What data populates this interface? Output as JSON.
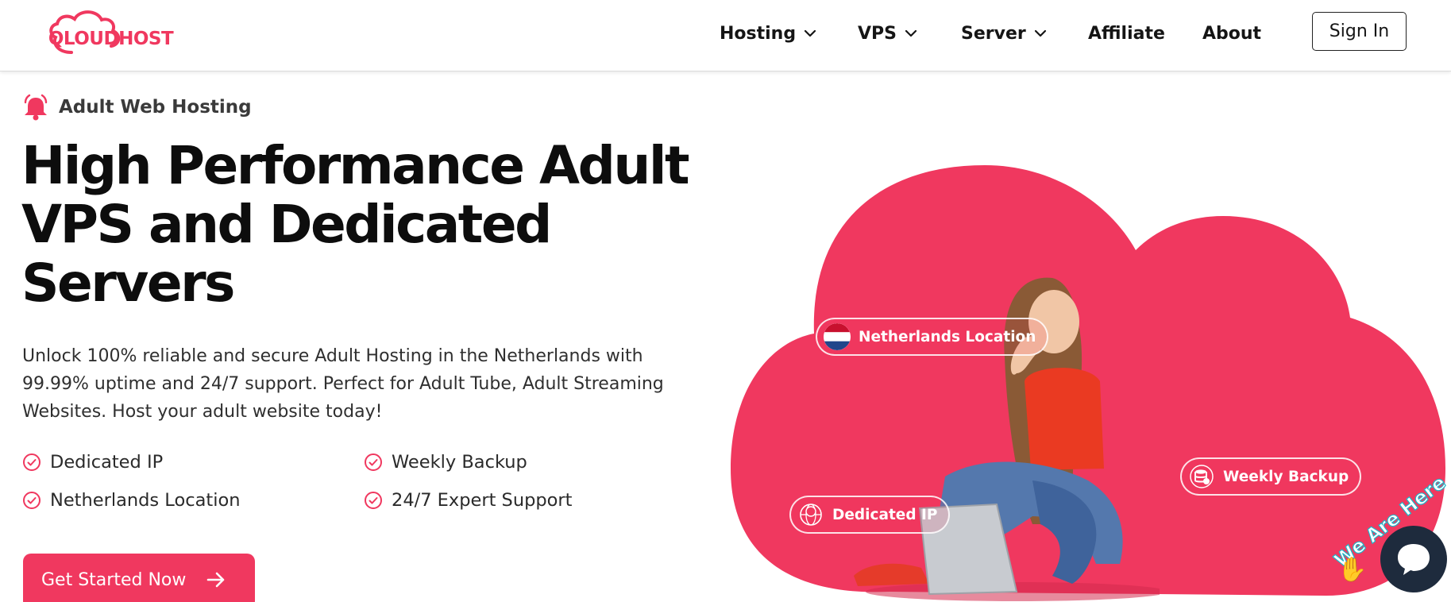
{
  "brand": {
    "logo_text_q": "Q",
    "logo_text_loud": "LOUD",
    "logo_text_host": "HOST",
    "color": "#f0385f"
  },
  "nav": {
    "items": [
      {
        "label": "Hosting",
        "has_dropdown": true
      },
      {
        "label": "VPS",
        "has_dropdown": true
      },
      {
        "label": "Server",
        "has_dropdown": true
      },
      {
        "label": "Affiliate",
        "has_dropdown": false
      },
      {
        "label": "About",
        "has_dropdown": false
      }
    ],
    "sign_in": "Sign In"
  },
  "hero": {
    "tagline_icon": "bell-icon",
    "tagline": "Adult Web Hosting",
    "headline_line1": "High Performance Adult",
    "headline_line2": "VPS and Dedicated",
    "headline_line3": "Servers",
    "description": "Unlock 100% reliable and secure Adult Hosting in the Netherlands with 99.99% uptime and 24/7 support. Perfect for Adult Tube, Adult Streaming Websites. Host your adult website today!",
    "features": [
      "Dedicated IP",
      "Weekly Backup",
      "Netherlands Location",
      "24/7 Expert Support"
    ],
    "cta": "Get Started Now"
  },
  "art": {
    "badges": [
      {
        "label": "Netherlands Location",
        "icon": "netherlands-flag-icon"
      },
      {
        "label": "Weekly Backup",
        "icon": "database-icon"
      },
      {
        "label": "Dedicated IP",
        "icon": "ip-globe-icon"
      }
    ],
    "accent": "#f0385f"
  },
  "chat": {
    "banner": "We Are Here",
    "icon": "chat-bubble-icon",
    "wave_icon": "waving-hand-icon"
  }
}
